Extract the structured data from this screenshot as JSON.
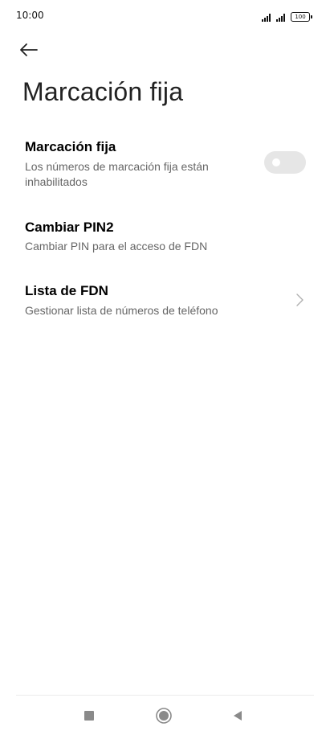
{
  "status_bar": {
    "time": "10:00",
    "battery_level": "100",
    "icons": [
      "signal-icon",
      "signal-icon",
      "battery-icon"
    ]
  },
  "header": {
    "back_icon": "arrow-left-icon",
    "title": "Marcación fija"
  },
  "settings": {
    "items": [
      {
        "title": "Marcación fija",
        "subtitle": "Los números de marcación fija están inhabilitados",
        "control": "toggle",
        "toggle_on": false
      },
      {
        "title": "Cambiar PIN2",
        "subtitle": "Cambiar PIN para el acceso de FDN",
        "control": "none"
      },
      {
        "title": "Lista de FDN",
        "subtitle": "Gestionar lista de números de teléfono",
        "control": "chevron-right-icon"
      }
    ]
  },
  "nav_bar": {
    "buttons": [
      "recents-square-icon",
      "home-circle-icon",
      "back-triangle-icon"
    ]
  },
  "colors": {
    "background": "#ffffff",
    "title_text": "#000000",
    "subtitle_text": "#666666",
    "toggle_off": "#e6e6e6",
    "chevron": "#b0b0b0",
    "nav_icons": "#8a8a8a"
  }
}
